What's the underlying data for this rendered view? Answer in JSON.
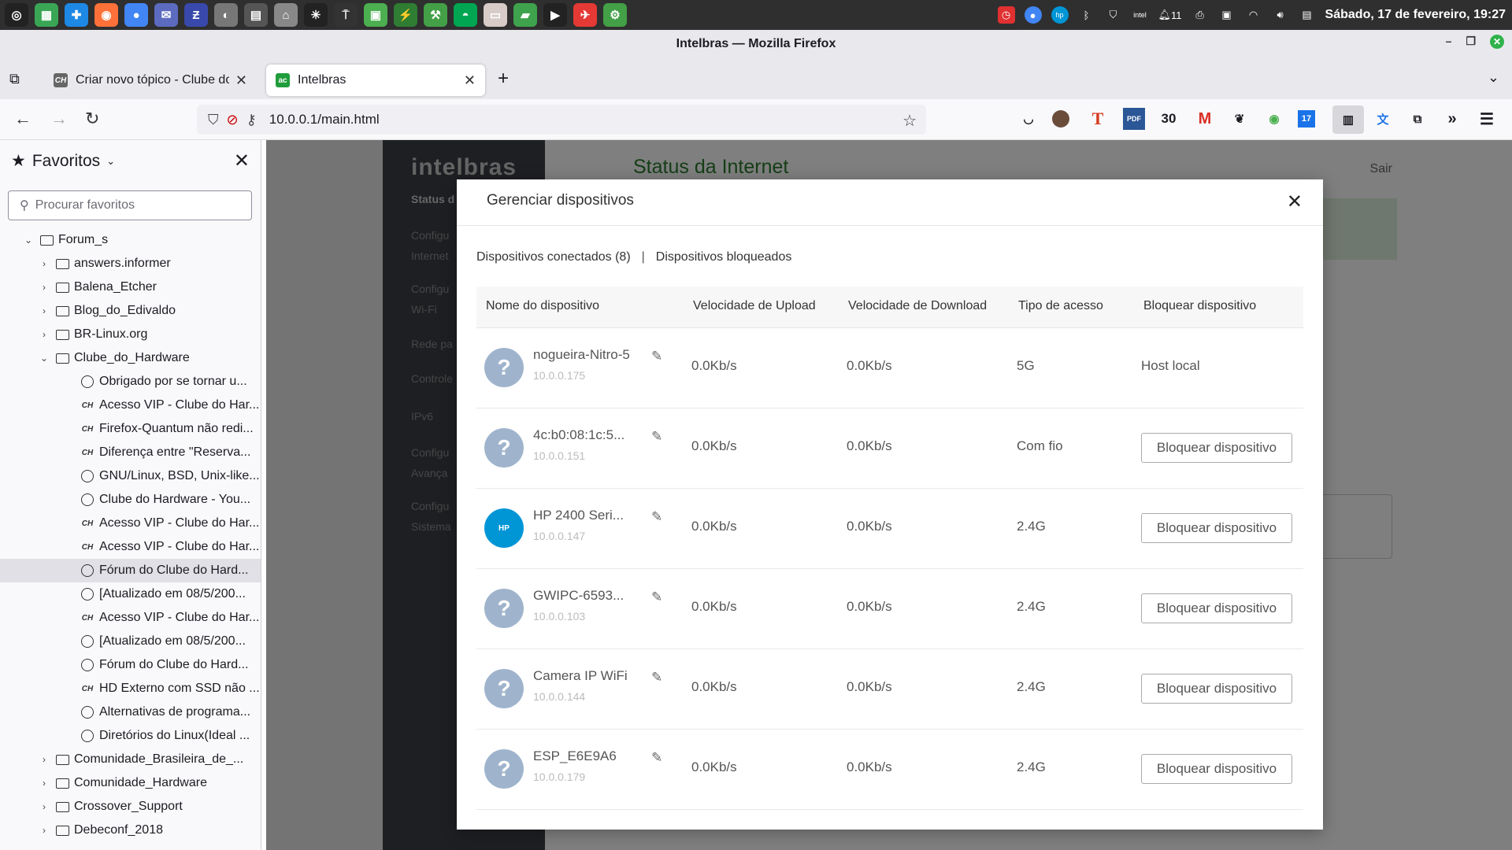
{
  "desktop": {
    "clock": "Sábado, 17 de fevereiro, 19:27",
    "tray_count": "11",
    "taskbar_icons": [
      "mint-menu-icon",
      "files-icon",
      "accessibility-icon",
      "firefox-icon",
      "chrome-icon",
      "mail-icon",
      "app-icon",
      "webcam-icon",
      "calculator-icon",
      "printer-icon",
      "terminal-icon",
      "app-icon",
      "app-icon",
      "app-icon",
      "app-icon",
      "app-icon",
      "files-icon",
      "terminal-icon",
      "app-icon",
      "app-icon",
      "settings-icon"
    ]
  },
  "window": {
    "title": "Intelbras — Mozilla Firefox"
  },
  "tabs": [
    {
      "label": "Criar novo tópico - Clube do Hardware",
      "favicon": "CH",
      "favicon_color": "#555555"
    },
    {
      "label": "Intelbras",
      "favicon": "ac",
      "favicon_color": "#1f9d3a"
    }
  ],
  "urlbar": {
    "url": "10.0.0.1/main.html"
  },
  "toolbar": {
    "ext_count": "30",
    "ext_pdf": "PDF",
    "ext_t": "T",
    "ext_g": "M",
    "ext_cal": "17"
  },
  "sidebar": {
    "title": "Favoritos",
    "search_placeholder": "Procurar favoritos",
    "items": [
      {
        "label": "Forum_s",
        "type": "folder",
        "level": 0,
        "open": true
      },
      {
        "label": "answers.informer",
        "type": "folder",
        "level": 1
      },
      {
        "label": "Balena_Etcher",
        "type": "folder",
        "level": 1
      },
      {
        "label": "Blog_do_Edivaldo",
        "type": "folder",
        "level": 1
      },
      {
        "label": "BR-Linux.org",
        "type": "folder",
        "level": 1
      },
      {
        "label": "Clube_do_Hardware",
        "type": "folder",
        "level": 1,
        "open": true
      },
      {
        "label": "Obrigado por se tornar u...",
        "type": "bookmark",
        "icon": "globe",
        "level": 2
      },
      {
        "label": "Acesso VIP - Clube do Har...",
        "type": "bookmark",
        "icon": "ch",
        "level": 2
      },
      {
        "label": "Firefox-Quantum não redi...",
        "type": "bookmark",
        "icon": "ch",
        "level": 2
      },
      {
        "label": "Diferença entre \"Reserva...",
        "type": "bookmark",
        "icon": "ch",
        "level": 2
      },
      {
        "label": "GNU/Linux, BSD, Unix-like...",
        "type": "bookmark",
        "icon": "globe",
        "level": 2
      },
      {
        "label": "Clube do Hardware - You...",
        "type": "bookmark",
        "icon": "globe",
        "level": 2
      },
      {
        "label": "Acesso VIP - Clube do Har...",
        "type": "bookmark",
        "icon": "ch",
        "level": 2
      },
      {
        "label": "Acesso VIP - Clube do Har...",
        "type": "bookmark",
        "icon": "ch",
        "level": 2
      },
      {
        "label": "Fórum do Clube do Hard...",
        "type": "bookmark",
        "icon": "globe",
        "level": 2,
        "selected": true
      },
      {
        "label": "[Atualizado em 08/5/200...",
        "type": "bookmark",
        "icon": "globe",
        "level": 2
      },
      {
        "label": "Acesso VIP - Clube do Har...",
        "type": "bookmark",
        "icon": "ch",
        "level": 2
      },
      {
        "label": "[Atualizado em 08/5/200...",
        "type": "bookmark",
        "icon": "globe",
        "level": 2
      },
      {
        "label": "Fórum do Clube do Hard...",
        "type": "bookmark",
        "icon": "globe",
        "level": 2
      },
      {
        "label": "HD Externo com SSD não ...",
        "type": "bookmark",
        "icon": "ch",
        "level": 2
      },
      {
        "label": "Alternativas de programa...",
        "type": "bookmark",
        "icon": "globe",
        "level": 2
      },
      {
        "label": "Diretórios do Linux(Ideal ...",
        "type": "bookmark",
        "icon": "globe",
        "level": 2
      },
      {
        "label": "Comunidade_Brasileira_de_...",
        "type": "folder",
        "level": 1
      },
      {
        "label": "Comunidade_Hardware",
        "type": "folder",
        "level": 1
      },
      {
        "label": "Crossover_Support",
        "type": "folder",
        "level": 1
      },
      {
        "label": "Debeconf_2018",
        "type": "folder",
        "level": 1
      }
    ]
  },
  "router": {
    "logo": "intelbras",
    "page_title": "Status da Internet",
    "logout": "Sair",
    "menu": [
      {
        "label": "Status d",
        "bold": true
      },
      {
        "label": "Configu\nInternet"
      },
      {
        "label": "Configu\nWi-Fi"
      },
      {
        "label": "Rede pa"
      },
      {
        "label": "Controle"
      },
      {
        "label": "IPv6"
      },
      {
        "label": "Configu\nAvança"
      },
      {
        "label": "Configu\nSistema"
      }
    ]
  },
  "modal": {
    "title": "Gerenciar dispositivos",
    "tab_connected": "Dispositivos conectados (8)",
    "tab_separator": "|",
    "tab_blocked": "Dispositivos bloqueados",
    "columns": {
      "name": "Nome do dispositivo",
      "upload": "Velocidade de Upload",
      "download": "Velocidade de Download",
      "access": "Tipo de acesso",
      "block": "Bloquear dispositivo"
    },
    "devices": [
      {
        "name": "nogueira-Nitro-5",
        "ip": "10.0.0.175",
        "upload": "0.0Kb/s",
        "download": "0.0Kb/s",
        "access": "5G",
        "status": "Host local",
        "avatar": "?"
      },
      {
        "name": "4c:b0:08:1c:5...",
        "ip": "10.0.0.151",
        "upload": "0.0Kb/s",
        "download": "0.0Kb/s",
        "access": "Com fio",
        "button": "Bloquear dispositivo",
        "avatar": "?"
      },
      {
        "name": "HP 2400 Seri...",
        "ip": "10.0.0.147",
        "upload": "0.0Kb/s",
        "download": "0.0Kb/s",
        "access": "2.4G",
        "button": "Bloquear dispositivo",
        "avatar": "HP"
      },
      {
        "name": "GWIPC-6593...",
        "ip": "10.0.0.103",
        "upload": "0.0Kb/s",
        "download": "0.0Kb/s",
        "access": "2.4G",
        "button": "Bloquear dispositivo",
        "avatar": "?"
      },
      {
        "name": "Camera IP WiFi",
        "ip": "10.0.0.144",
        "upload": "0.0Kb/s",
        "download": "0.0Kb/s",
        "access": "2.4G",
        "button": "Bloquear dispositivo",
        "avatar": "?"
      },
      {
        "name": "ESP_E6E9A6",
        "ip": "10.0.0.179",
        "upload": "0.0Kb/s",
        "download": "0.0Kb/s",
        "access": "2.4G",
        "button": "Bloquear dispositivo",
        "avatar": "?"
      }
    ]
  }
}
